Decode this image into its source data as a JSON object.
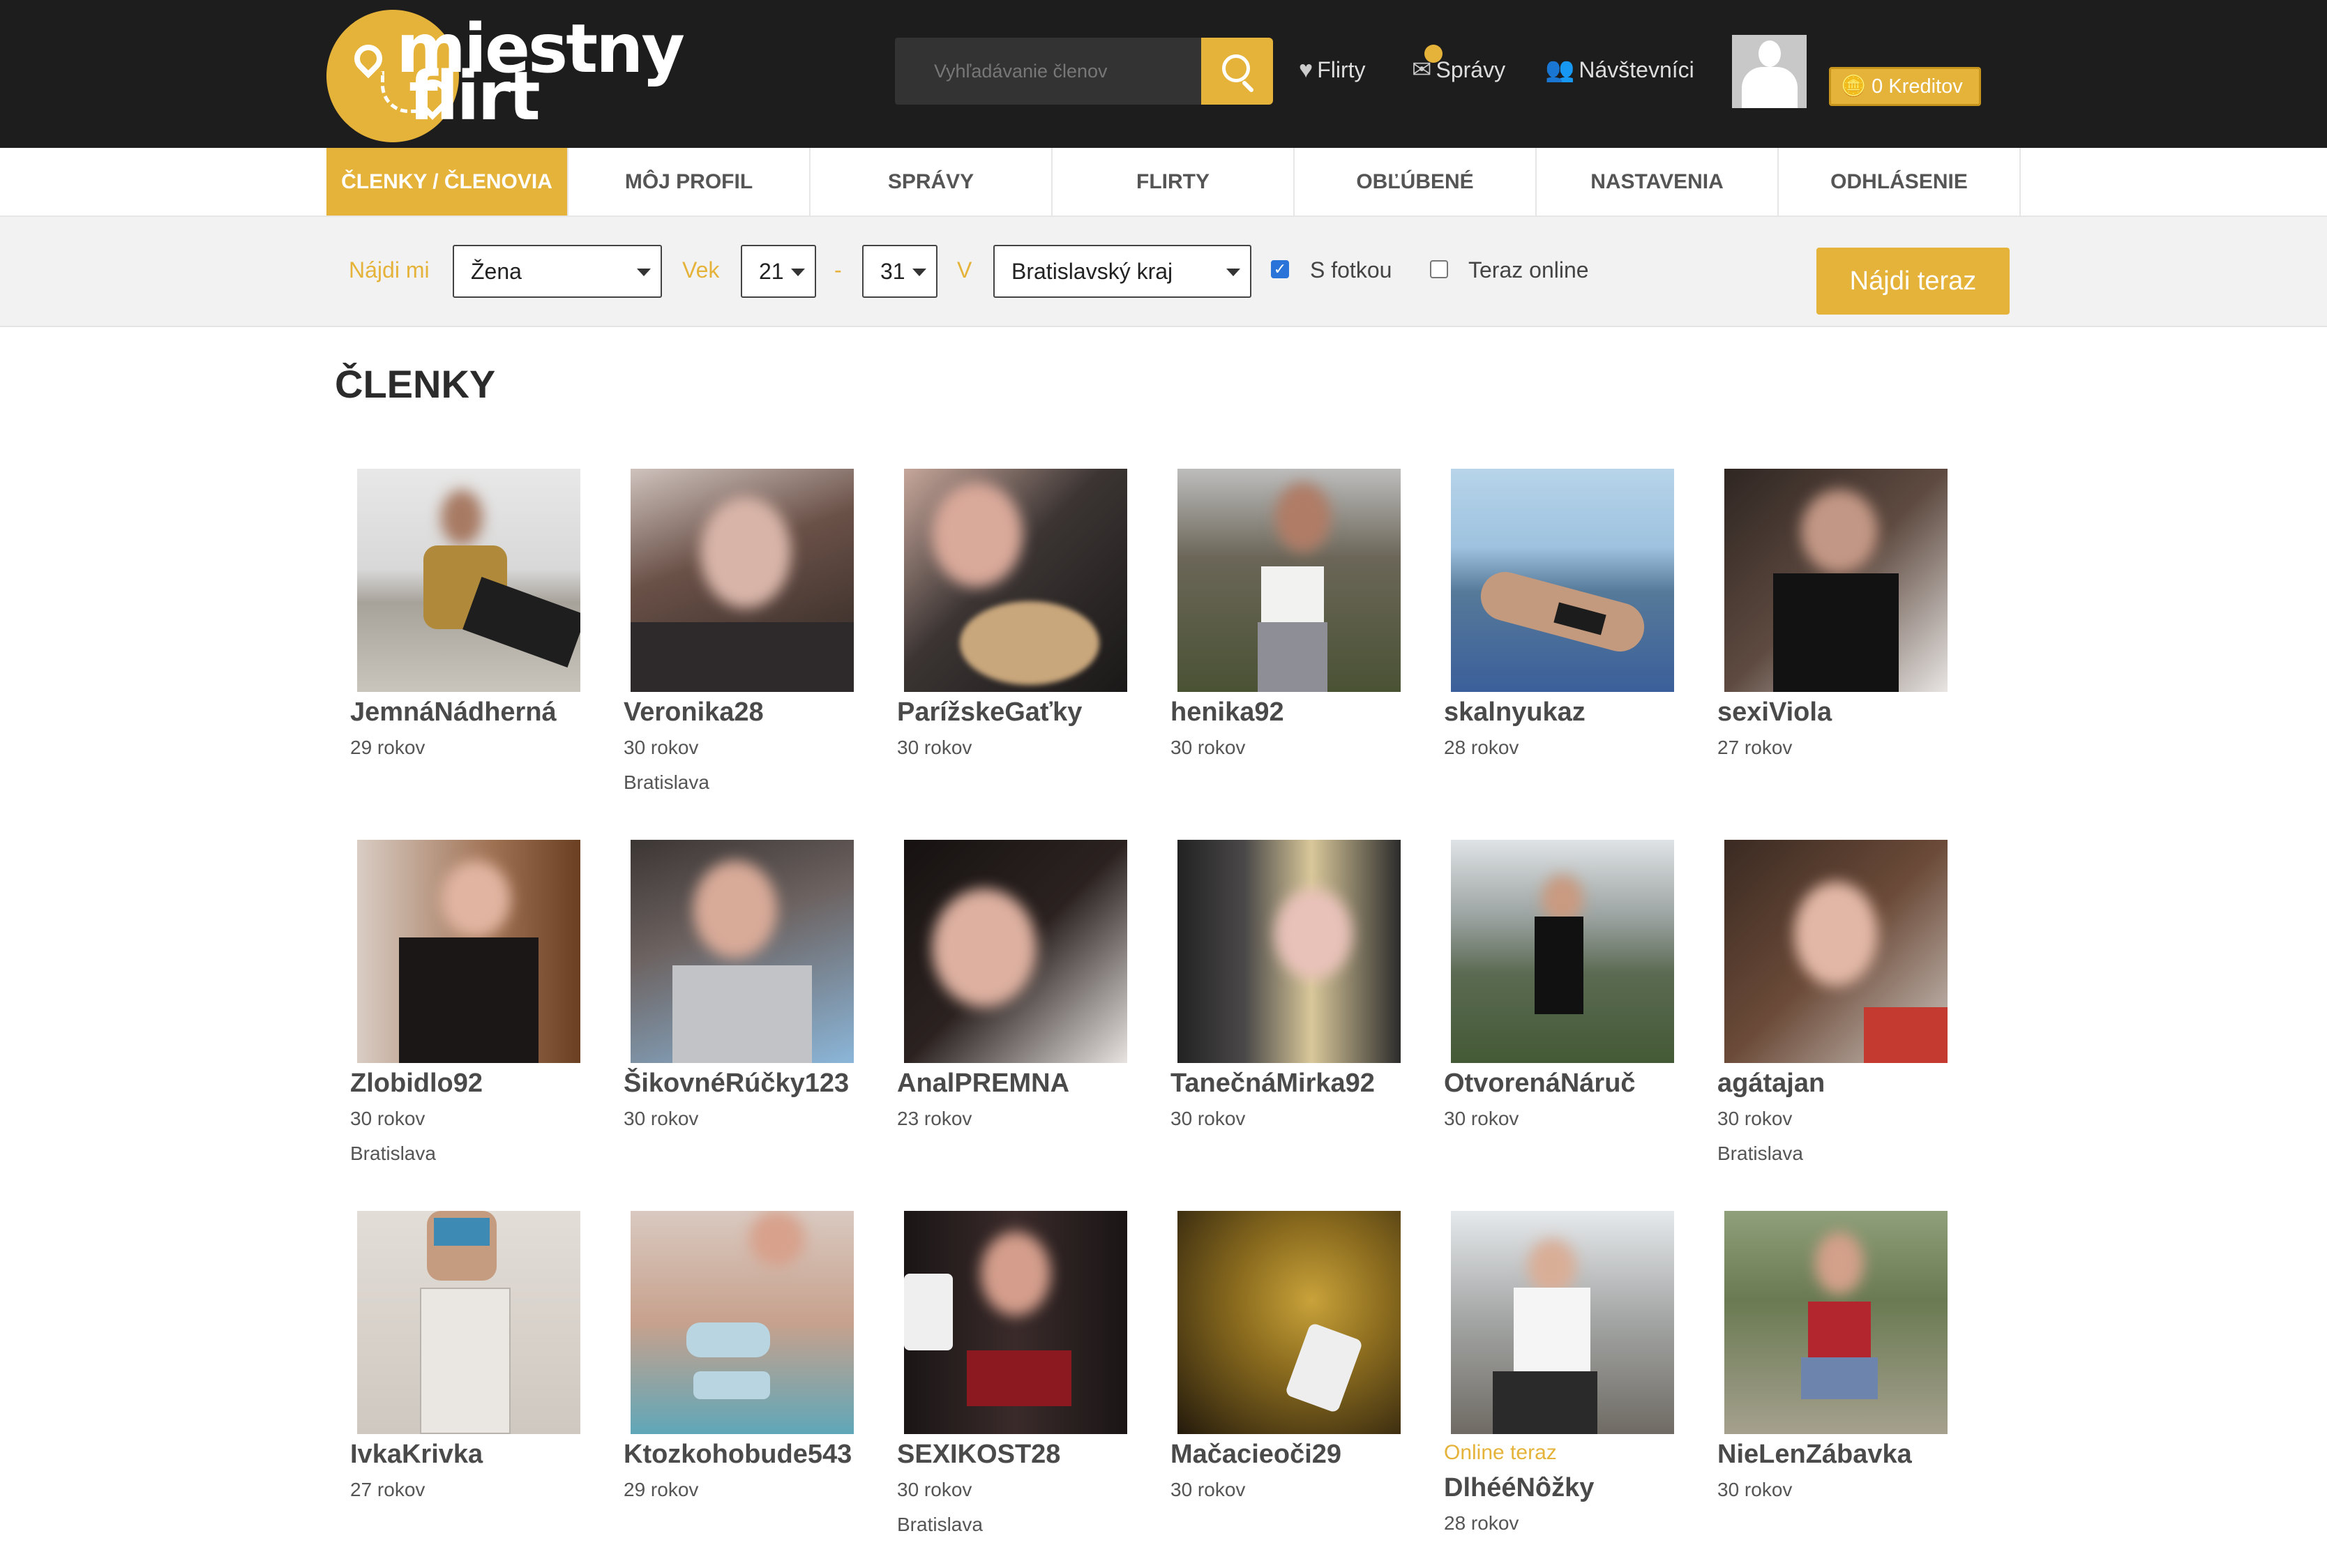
{
  "header": {
    "logo": {
      "line1": "miestny",
      "line2": "flirt"
    },
    "search_placeholder": "Vyhľadávanie členov",
    "nav": [
      {
        "label": "Flirty",
        "icon": "heart-icon"
      },
      {
        "label": "Správy",
        "icon": "envelope-icon"
      },
      {
        "label": "Návštevníci",
        "icon": "users-icon"
      }
    ],
    "credits_label": "0 Kreditov"
  },
  "tabs": [
    {
      "label": "ČLENKY / ČLENOVIA",
      "active": true
    },
    {
      "label": "MÔJ PROFIL"
    },
    {
      "label": "SPRÁVY"
    },
    {
      "label": "FLIRTY"
    },
    {
      "label": "OBĽÚBENÉ"
    },
    {
      "label": "NASTAVENIA"
    },
    {
      "label": "ODHLÁSENIE"
    }
  ],
  "filter": {
    "find_me_label": "Nájdi mi",
    "gender_value": "Žena",
    "age_label": "Vek",
    "age_from": "21",
    "age_dash": "-",
    "age_to": "31",
    "in_label": "V",
    "region_value": "Bratislavský kraj",
    "with_photo_label": "S fotkou",
    "with_photo_checked": true,
    "online_now_label": "Teraz online",
    "online_now_checked": false,
    "submit_label": "Nájdi teraz"
  },
  "page_title": "ČLENKY",
  "members": [
    {
      "name": "JemnáNádherná",
      "age": "29 rokov",
      "city": ""
    },
    {
      "name": "Veronika28",
      "age": "30 rokov",
      "city": "Bratislava"
    },
    {
      "name": "ParížskeGaťky",
      "age": "30 rokov",
      "city": ""
    },
    {
      "name": "henika92",
      "age": "30 rokov",
      "city": ""
    },
    {
      "name": "skalnyukaz",
      "age": "28 rokov",
      "city": ""
    },
    {
      "name": "sexiViola",
      "age": "27 rokov",
      "city": ""
    },
    {
      "name": "Zlobidlo92",
      "age": "30 rokov",
      "city": "Bratislava"
    },
    {
      "name": "ŠikovnéRúčky123",
      "age": "30 rokov",
      "city": ""
    },
    {
      "name": "AnalPREMNA",
      "age": "23 rokov",
      "city": ""
    },
    {
      "name": "TanečnáMirka92",
      "age": "30 rokov",
      "city": ""
    },
    {
      "name": "OtvorenáNáruč",
      "age": "30 rokov",
      "city": ""
    },
    {
      "name": "agátajan",
      "age": "30 rokov",
      "city": "Bratislava"
    },
    {
      "name": "IvkaKrivka",
      "age": "27 rokov",
      "city": ""
    },
    {
      "name": "Ktozkohobude543",
      "age": "29 rokov",
      "city": ""
    },
    {
      "name": "SEXIKOST28",
      "age": "30 rokov",
      "city": "Bratislava"
    },
    {
      "name": "Mačacieoči29",
      "age": "30 rokov",
      "city": ""
    },
    {
      "name": "DlhééNôžky",
      "age": "28 rokov",
      "city": "",
      "online_label": "Online teraz"
    },
    {
      "name": "NieLenZábavka",
      "age": "30 rokov",
      "city": ""
    }
  ],
  "colors": {
    "accent": "#e5b33a",
    "header_bg": "#1d1d1d"
  }
}
